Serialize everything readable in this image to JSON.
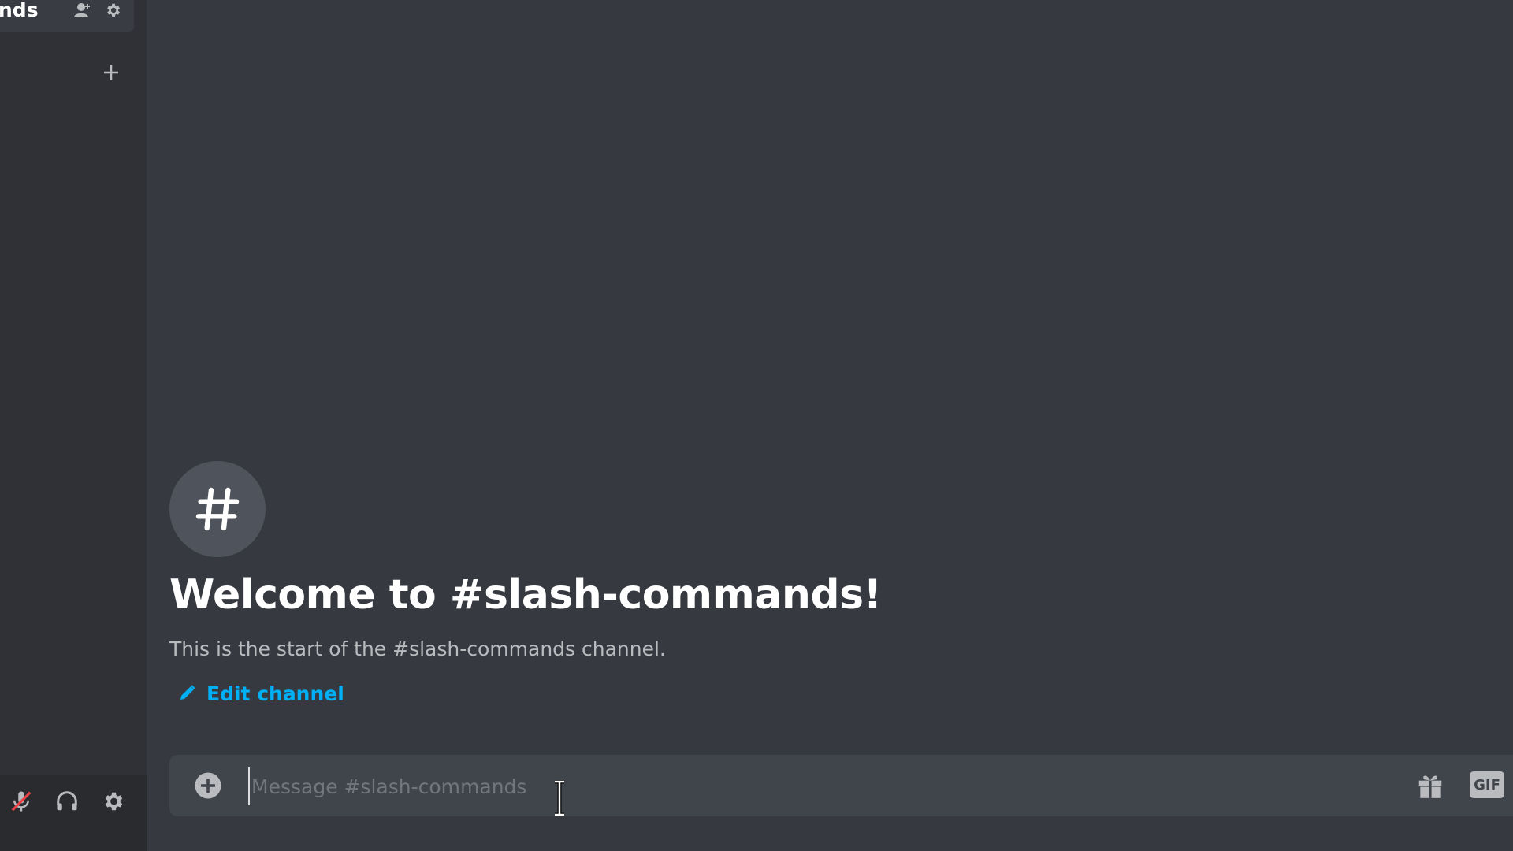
{
  "sidebar": {
    "channel_name_partial": "nds",
    "add_channel_icon": "plus-icon",
    "icons": [
      "invite-person-icon",
      "gear-icon"
    ],
    "user_panel": {
      "icons": [
        "microphone-muted-icon",
        "headphones-icon",
        "gear-icon"
      ]
    }
  },
  "main": {
    "channel_icon": "hash-icon",
    "welcome_title": "Welcome to #slash-commands!",
    "welcome_subtitle": "This is the start of the #slash-commands channel.",
    "edit_channel_label": "Edit channel"
  },
  "composer": {
    "placeholder": "Message #slash-commands",
    "value": "",
    "gif_label": "GIF"
  },
  "colors": {
    "link": "#00aff4",
    "muted_red": "#ed4245",
    "background": "#36393f"
  }
}
